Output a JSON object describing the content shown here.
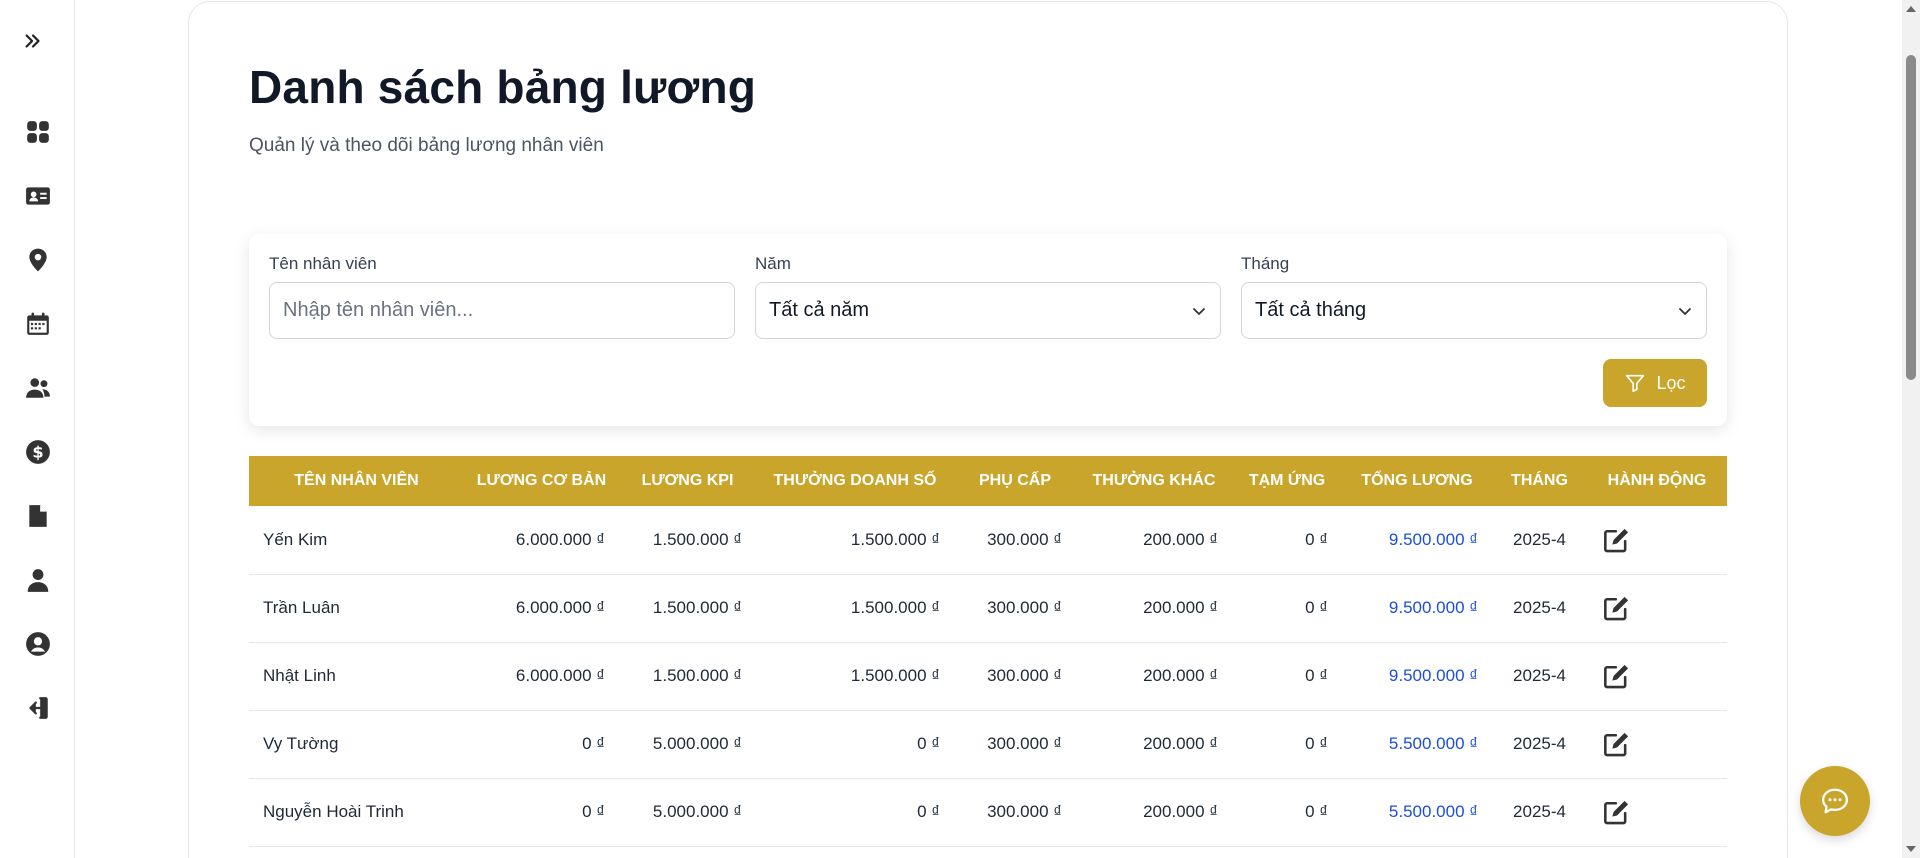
{
  "page": {
    "title": "Danh sách bảng lương",
    "subtitle": "Quản lý và theo dõi bảng lương nhân viên"
  },
  "sidebar": {
    "toggle_icon": "double-chevron-right-icon",
    "items": [
      {
        "icon": "dashboard-grid-icon"
      },
      {
        "icon": "id-card-icon"
      },
      {
        "icon": "location-pin-icon"
      },
      {
        "icon": "calendar-icon"
      },
      {
        "icon": "users-icon"
      },
      {
        "icon": "dollar-circle-icon"
      },
      {
        "icon": "file-icon"
      },
      {
        "icon": "user-icon"
      },
      {
        "icon": "user-circle-icon"
      },
      {
        "icon": "logout-icon"
      }
    ]
  },
  "filters": {
    "name_label": "Tên nhân viên",
    "name_placeholder": "Nhập tên nhân viên...",
    "name_value": "",
    "year_label": "Năm",
    "year_value": "Tất cả năm",
    "month_label": "Tháng",
    "month_value": "Tất cả tháng",
    "filter_button": "Lọc"
  },
  "table": {
    "headers": [
      "Tên nhân viên",
      "Lương cơ bản",
      "Lương KPI",
      "Thưởng doanh số",
      "Phụ cấp",
      "Thưởng khác",
      "Tạm ứng",
      "Tổng lương",
      "Tháng",
      "Hành động"
    ],
    "rows": [
      {
        "name": "Yến Kim",
        "base": "6.000.000 ₫",
        "kpi": "1.500.000 ₫",
        "sales_bonus": "1.500.000 ₫",
        "allowance": "300.000 ₫",
        "other_bonus": "200.000 ₫",
        "advance": "0 ₫",
        "total": "9.500.000 ₫",
        "month": "2025-4"
      },
      {
        "name": "Trần Luân",
        "base": "6.000.000 ₫",
        "kpi": "1.500.000 ₫",
        "sales_bonus": "1.500.000 ₫",
        "allowance": "300.000 ₫",
        "other_bonus": "200.000 ₫",
        "advance": "0 ₫",
        "total": "9.500.000 ₫",
        "month": "2025-4"
      },
      {
        "name": "Nhật Linh",
        "base": "6.000.000 ₫",
        "kpi": "1.500.000 ₫",
        "sales_bonus": "1.500.000 ₫",
        "allowance": "300.000 ₫",
        "other_bonus": "200.000 ₫",
        "advance": "0 ₫",
        "total": "9.500.000 ₫",
        "month": "2025-4"
      },
      {
        "name": "Vy Tường",
        "base": "0 ₫",
        "kpi": "5.000.000 ₫",
        "sales_bonus": "0 ₫",
        "allowance": "300.000 ₫",
        "other_bonus": "200.000 ₫",
        "advance": "0 ₫",
        "total": "5.500.000 ₫",
        "month": "2025-4"
      },
      {
        "name": "Nguyễn Hoài Trinh",
        "base": "0 ₫",
        "kpi": "5.000.000 ₫",
        "sales_bonus": "0 ₫",
        "allowance": "300.000 ₫",
        "other_bonus": "200.000 ₫",
        "advance": "0 ₫",
        "total": "5.500.000 ₫",
        "month": "2025-4"
      }
    ]
  },
  "colors": {
    "accent": "#c9a52c",
    "total_text": "#1d4ed8",
    "title_text": "#111827"
  },
  "chat_fab_icon": "chat-bubble-icon"
}
